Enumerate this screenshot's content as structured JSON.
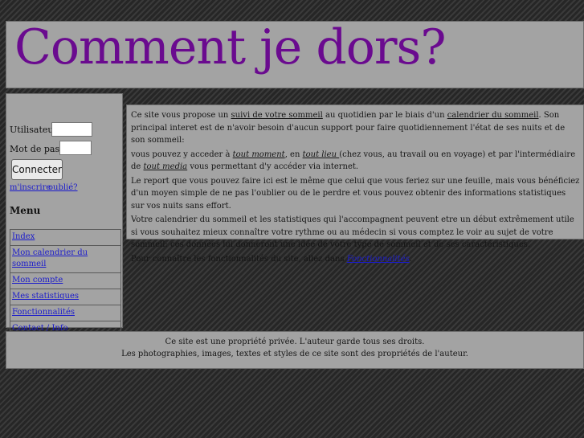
{
  "header": {
    "title": "Comment je dors?"
  },
  "login": {
    "user_label": "Utilisateur:",
    "user_value": "",
    "pass_label": "Mot de passe:",
    "pass_value": "",
    "connect_label": "Connecter",
    "register_link": "m'inscrire",
    "forgot_link": "oublié?"
  },
  "menu": {
    "title": "Menu",
    "items": [
      {
        "label": "Index"
      },
      {
        "label": "Mon calendrier du sommeil"
      },
      {
        "label": "Mon compte"
      },
      {
        "label": "Mes statistiques"
      },
      {
        "label": "Fonctionnalités"
      },
      {
        "label": "Contact / Info"
      }
    ]
  },
  "content": {
    "p1_a": "Ce site vous propose un ",
    "p1_link1": "suivi de votre sommeil",
    "p1_b": " au quotidien par le biais d'un ",
    "p1_link2": "calendrier du sommeil",
    "p1_c": ". Son principal interet est de n'avoir besoin d'aucun support pour faire quotidiennement l'état de ses nuits et de son sommeil:",
    "p2_a": "vous pouvez y acceder à ",
    "p2_em1": "tout moment",
    "p2_b": ", en ",
    "p2_em2": "tout lieu ",
    "p2_c": " (chez vous, au travail ou en voyage) et par l'intermédiaire de ",
    "p2_em3": "tout media",
    "p2_d": " vous permettant d'y accéder via internet.",
    "p3": "Le report que vous pouvez faire ici est le même que celui que vous feriez sur une feuille, mais vous bénéficiez d'un moyen simple de ne pas l'oublier ou de le perdre et vous pouvez obtenir des informations statistiques sur vos nuits sans effort.",
    "p4": "Votre calendrier du sommeil et les statistiques qui l'accompagnent peuvent etre un début extrêmement utile si vous souhaitez mieux connaître votre rythme ou au médecin si vous comptez le voir au sujet de votre sommeil: ces données lui donneront une idée de votre type de sommeil et de ses caractéristiques.",
    "p5_a": "Pour connaître les fonctionnalités du site, allez dans ",
    "p5_link": "Fonctionnalités",
    "p5_b": "."
  },
  "footer": {
    "line1": "Ce site est une propriété privée. L'auteur garde tous ses droits.",
    "line2": "Les photographies, images, textes et styles de ce site sont des propriétés de l'auteur."
  }
}
